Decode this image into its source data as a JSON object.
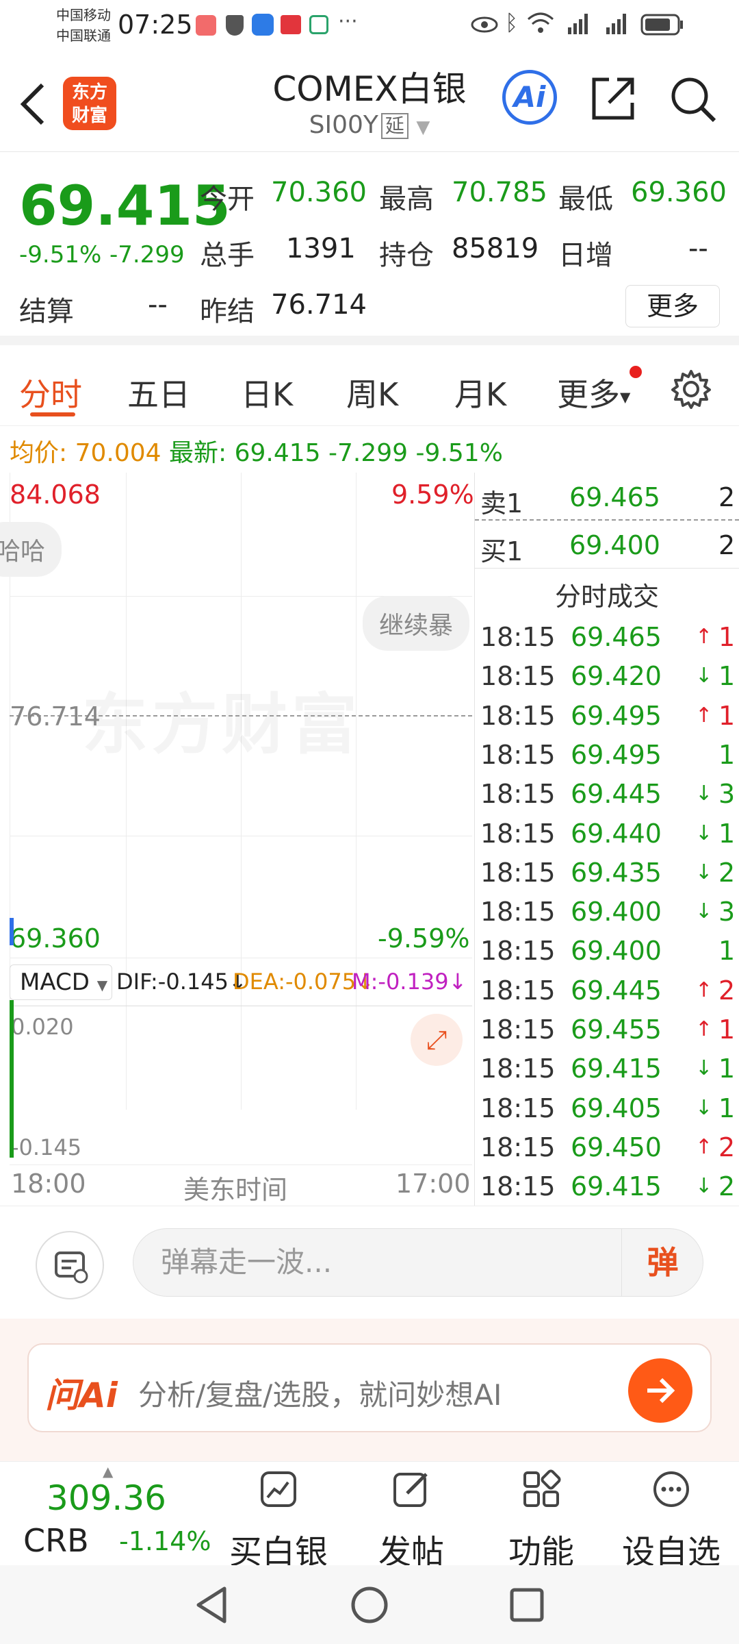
{
  "status_bar": {
    "carrier1": "中国移动",
    "carrier2": "中国联通",
    "time": "07:25"
  },
  "header": {
    "logo_line1": "东方",
    "logo_line2": "财富",
    "title": "COMEX白银",
    "code": "SI00Y",
    "delay_badge": "延",
    "ai_label": "Ai"
  },
  "quote": {
    "price": "69.415",
    "change_pct": "-9.51%",
    "change": "-7.299",
    "open_label": "今开",
    "open": "70.360",
    "high_label": "最高",
    "high": "70.785",
    "low_label": "最低",
    "low": "69.360",
    "volume_label": "总手",
    "volume": "1391",
    "oi_label": "持仓",
    "oi": "85819",
    "daily_inc_label": "日增",
    "daily_inc": "--",
    "settle_label": "结算",
    "settle": "--",
    "prev_settle_label": "昨结",
    "prev_settle": "76.714",
    "more_label": "更多"
  },
  "tabs": [
    {
      "label": "分时"
    },
    {
      "label": "五日"
    },
    {
      "label": "日K"
    },
    {
      "label": "周K"
    },
    {
      "label": "月K"
    },
    {
      "label": "更多"
    }
  ],
  "avg_line": {
    "avg_label": "均价:",
    "avg": "70.004",
    "latest_label": "最新:",
    "latest": "69.415",
    "change": "-7.299",
    "pct": "-9.51%"
  },
  "chart": {
    "top_price": "84.068",
    "top_pct": "9.59%",
    "mid_price": "76.714",
    "bottom_price": "69.360",
    "bottom_pct": "-9.59%",
    "danmu1": "哈哈",
    "danmu2": "继续暴",
    "watermark": "东方财富",
    "macd_label": "MACD",
    "dif": "DIF:-0.145",
    "dea": "DEA:-0.075",
    "m": "M:-0.139",
    "macd_top": "0.020",
    "macd_bottom": "-0.145",
    "x_start": "18:00",
    "x_mid": "美东时间",
    "x_end": "17:00"
  },
  "book": {
    "sell_label": "卖1",
    "sell_price": "69.465",
    "sell_qty": "2",
    "buy_label": "买1",
    "buy_price": "69.400",
    "buy_qty": "2",
    "trades_title": "分时成交",
    "trades": [
      {
        "time": "18:15",
        "price": "69.465",
        "dir": "up",
        "qty": "1"
      },
      {
        "time": "18:15",
        "price": "69.420",
        "dir": "down",
        "qty": "1"
      },
      {
        "time": "18:15",
        "price": "69.495",
        "dir": "up",
        "qty": "1"
      },
      {
        "time": "18:15",
        "price": "69.495",
        "dir": "none",
        "qty": "1"
      },
      {
        "time": "18:15",
        "price": "69.445",
        "dir": "down",
        "qty": "3"
      },
      {
        "time": "18:15",
        "price": "69.440",
        "dir": "down",
        "qty": "1"
      },
      {
        "time": "18:15",
        "price": "69.435",
        "dir": "down",
        "qty": "2"
      },
      {
        "time": "18:15",
        "price": "69.400",
        "dir": "down",
        "qty": "3"
      },
      {
        "time": "18:15",
        "price": "69.400",
        "dir": "none",
        "qty": "1"
      },
      {
        "time": "18:15",
        "price": "69.445",
        "dir": "up",
        "qty": "2"
      },
      {
        "time": "18:15",
        "price": "69.455",
        "dir": "up",
        "qty": "1"
      },
      {
        "time": "18:15",
        "price": "69.415",
        "dir": "down",
        "qty": "1"
      },
      {
        "time": "18:15",
        "price": "69.405",
        "dir": "down",
        "qty": "1"
      },
      {
        "time": "18:15",
        "price": "69.450",
        "dir": "up",
        "qty": "2"
      },
      {
        "time": "18:15",
        "price": "69.415",
        "dir": "down",
        "qty": "2"
      }
    ]
  },
  "comment": {
    "placeholder": "弹幕走一波...",
    "danmu_btn": "弹"
  },
  "ai_bar": {
    "logo": "问Ai",
    "placeholder": "分析/复盘/选股，就问妙想AI"
  },
  "bottom_nav": {
    "index_value": "309.36",
    "index_name": "CRB",
    "index_pct": "-1.14%",
    "items": [
      {
        "label": "买白银"
      },
      {
        "label": "发帖"
      },
      {
        "label": "功能"
      },
      {
        "label": "设自选"
      }
    ]
  },
  "colors": {
    "up": "#e0202a",
    "down": "#1a9b1a",
    "accent": "#e8501e"
  }
}
